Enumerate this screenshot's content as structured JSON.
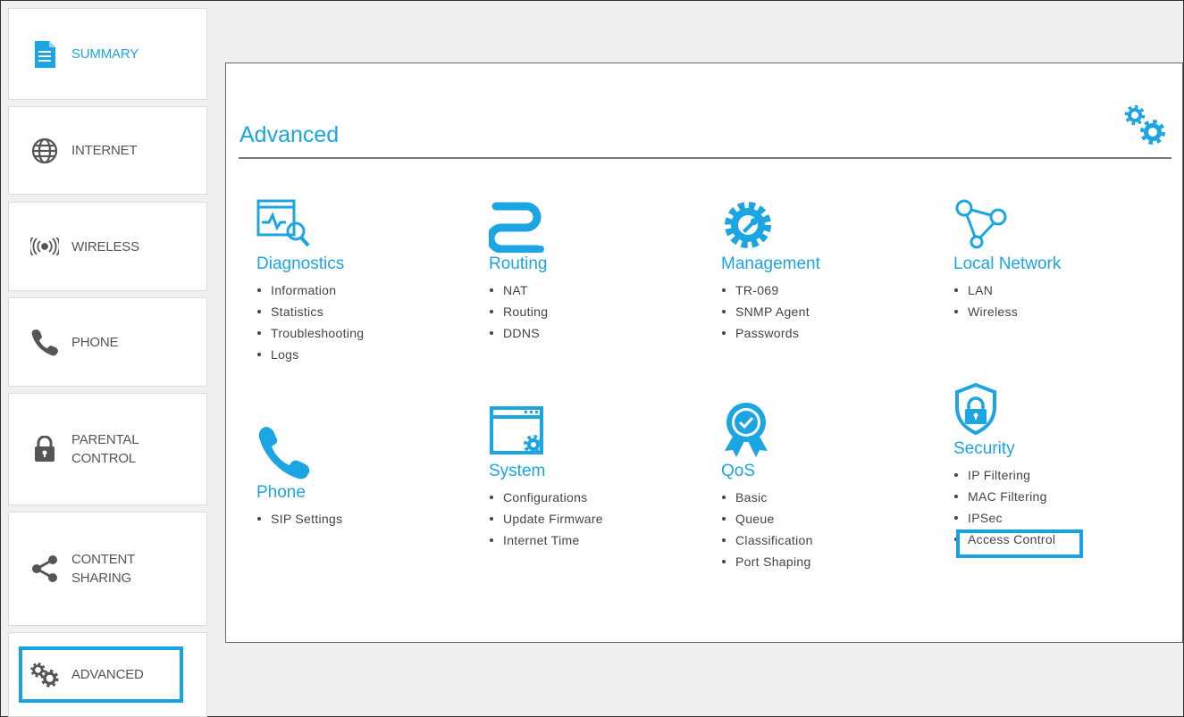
{
  "sidebar": {
    "items": [
      {
        "key": "summary",
        "label": "SUMMARY",
        "active": true
      },
      {
        "key": "internet",
        "label": "INTERNET"
      },
      {
        "key": "wireless",
        "label": "WIRELESS"
      },
      {
        "key": "phone",
        "label": "PHONE"
      },
      {
        "key": "parental",
        "label_line1": "PARENTAL",
        "label_line2": "CONTROL"
      },
      {
        "key": "content",
        "label_line1": "CONTENT",
        "label_line2": "SHARING"
      },
      {
        "key": "advanced",
        "label": "ADVANCED"
      }
    ]
  },
  "main": {
    "title": "Advanced",
    "sections": [
      {
        "title": "Diagnostics",
        "items": [
          "Information",
          "Statistics",
          "Troubleshooting",
          "Logs"
        ]
      },
      {
        "title": "Routing",
        "items": [
          "NAT",
          "Routing",
          "DDNS"
        ]
      },
      {
        "title": "Management",
        "items": [
          "TR-069",
          "SNMP Agent",
          "Passwords"
        ]
      },
      {
        "title": "Local Network",
        "items": [
          "LAN",
          "Wireless"
        ]
      },
      {
        "title": "Phone",
        "items": [
          "SIP Settings"
        ]
      },
      {
        "title": "System",
        "items": [
          "Configurations",
          "Update Firmware",
          "Internet Time"
        ]
      },
      {
        "title": "QoS",
        "items": [
          "Basic",
          "Queue",
          "Classification",
          "Port Shaping"
        ]
      },
      {
        "title": "Security",
        "items": [
          "IP Filtering",
          "MAC Filtering",
          "IPSec",
          "Access Control"
        ]
      }
    ]
  },
  "colors": {
    "accent": "#1ba6e3",
    "highlight": "#16a3e6",
    "icon_gray": "#555555"
  }
}
